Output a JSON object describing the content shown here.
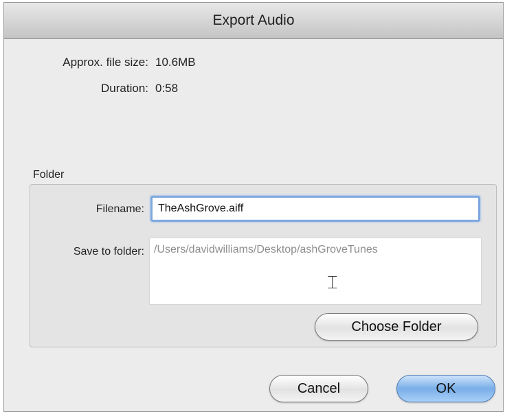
{
  "window": {
    "title": "Export Audio"
  },
  "info": {
    "file_size_label": "Approx. file size:",
    "file_size_value": "10.6MB",
    "duration_label": "Duration:",
    "duration_value": "0:58"
  },
  "folder_section": {
    "label": "Folder",
    "filename_label": "Filename:",
    "filename_value": "TheAshGrove.aiff",
    "save_to_label": "Save to folder:",
    "save_to_path": "/Users/davidwilliams/Desktop/ashGroveTunes",
    "choose_folder_label": "Choose Folder"
  },
  "buttons": {
    "cancel_label": "Cancel",
    "ok_label": "OK"
  },
  "colors": {
    "focus_ring": "#7ea7de",
    "default_button": "#79aee8"
  },
  "icons": {
    "cursor": "text-cursor-icon"
  }
}
